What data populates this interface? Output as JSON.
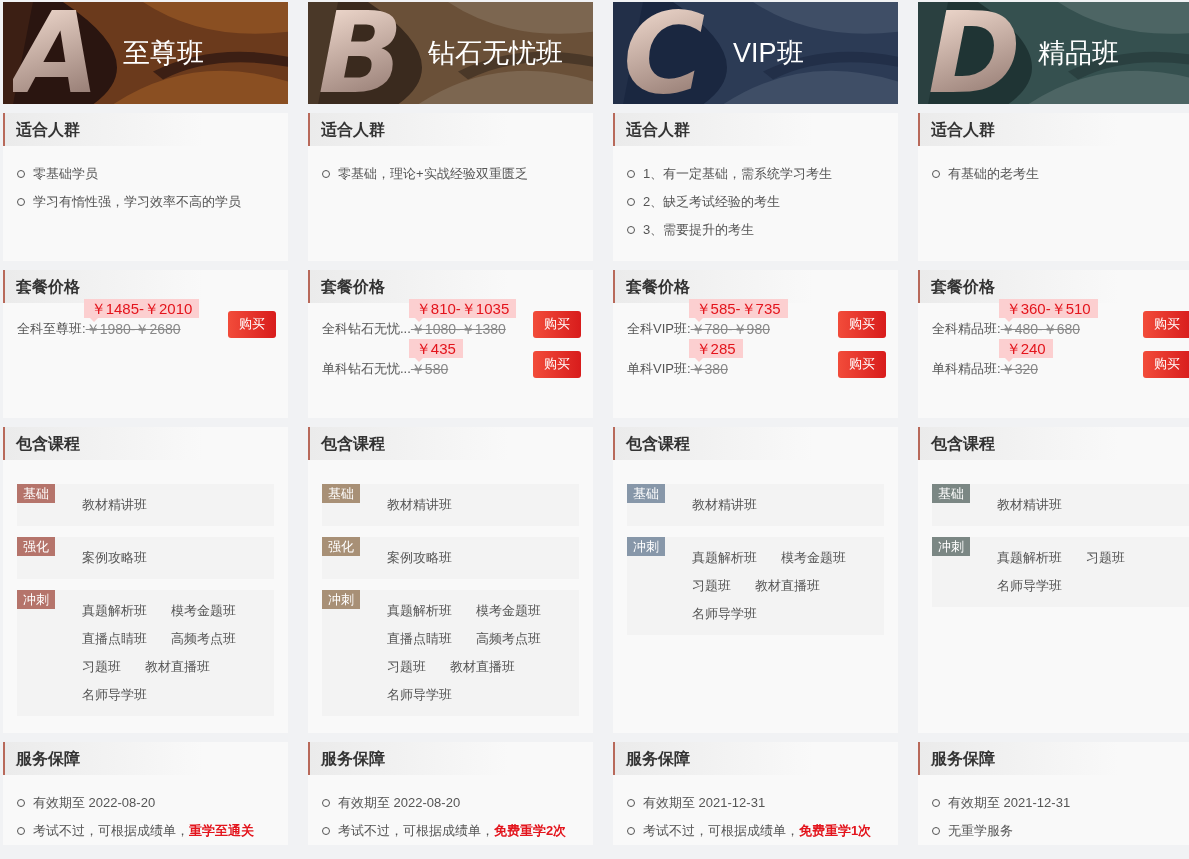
{
  "plans": [
    {
      "letter": "A",
      "title": "至尊班",
      "color": "#b5746b",
      "audience": {
        "title": "适合人群",
        "items": [
          "零基础学员",
          "学习有惰性强，学习效率不高的学员"
        ]
      },
      "pricing": {
        "title": "套餐价格",
        "rows": [
          {
            "label": "全科至尊班:",
            "original": "￥1980-￥2680",
            "sale": "￥1485-￥2010",
            "button": "购买"
          }
        ]
      },
      "courses": {
        "title": "包含课程",
        "groups": [
          {
            "stage": "基础",
            "items": [
              "教材精讲班"
            ]
          },
          {
            "stage": "强化",
            "items": [
              "案例攻略班"
            ]
          },
          {
            "stage": "冲刺",
            "items": [
              "真题解析班",
              "模考金题班",
              "直播点睛班",
              "高频考点班",
              "习题班",
              "教材直播班",
              "名师导学班"
            ]
          }
        ]
      },
      "service": {
        "title": "服务保障",
        "items": [
          "有效期至 2022-08-20",
          "考试不过，可根据成绩单，**重学至通关**"
        ]
      }
    },
    {
      "letter": "B",
      "title": "钻石无忧班",
      "color": "#a89076",
      "audience": {
        "title": "适合人群",
        "items": [
          "零基础，理论+实战经验双重匮乏"
        ]
      },
      "pricing": {
        "title": "套餐价格",
        "rows": [
          {
            "label": "全科钻石无忧...",
            "original": "￥1080-￥1380",
            "sale": "￥810-￥1035",
            "button": "购买"
          },
          {
            "label": "单科钻石无忧...",
            "original": "￥580",
            "sale": "￥435",
            "button": "购买"
          }
        ]
      },
      "courses": {
        "title": "包含课程",
        "groups": [
          {
            "stage": "基础",
            "items": [
              "教材精讲班"
            ]
          },
          {
            "stage": "强化",
            "items": [
              "案例攻略班"
            ]
          },
          {
            "stage": "冲刺",
            "items": [
              "真题解析班",
              "模考金题班",
              "直播点睛班",
              "高频考点班",
              "习题班",
              "教材直播班",
              "名师导学班"
            ]
          }
        ]
      },
      "service": {
        "title": "服务保障",
        "items": [
          "有效期至 2022-08-20",
          "考试不过，可根据成绩单，**免费重学2次**"
        ]
      }
    },
    {
      "letter": "C",
      "title": "VIP班",
      "color": "#8797a9",
      "audience": {
        "title": "适合人群",
        "items": [
          "1、有一定基础，需系统学习考生",
          "2、缺乏考试经验的考生",
          "3、需要提升的考生"
        ]
      },
      "pricing": {
        "title": "套餐价格",
        "rows": [
          {
            "label": "全科VIP班:",
            "original": "￥780-￥980",
            "sale": "￥585-￥735",
            "button": "购买"
          },
          {
            "label": "单科VIP班:",
            "original": "￥380",
            "sale": "￥285",
            "button": "购买"
          }
        ]
      },
      "courses": {
        "title": "包含课程",
        "groups": [
          {
            "stage": "基础",
            "items": [
              "教材精讲班"
            ]
          },
          {
            "stage": "冲刺",
            "items": [
              "真题解析班",
              "模考金题班",
              "习题班",
              "教材直播班",
              "名师导学班"
            ]
          }
        ]
      },
      "service": {
        "title": "服务保障",
        "items": [
          "有效期至 2021-12-31",
          "考试不过，可根据成绩单，**免费重学1次**"
        ]
      }
    },
    {
      "letter": "D",
      "title": "精品班",
      "color": "#7b8784",
      "audience": {
        "title": "适合人群",
        "items": [
          "有基础的老考生"
        ]
      },
      "pricing": {
        "title": "套餐价格",
        "rows": [
          {
            "label": "全科精品班:",
            "original": "￥480-￥680",
            "sale": "￥360-￥510",
            "button": "购买"
          },
          {
            "label": "单科精品班:",
            "original": "￥320",
            "sale": "￥240",
            "button": "购买"
          }
        ]
      },
      "courses": {
        "title": "包含课程",
        "groups": [
          {
            "stage": "基础",
            "items": [
              "教材精讲班"
            ]
          },
          {
            "stage": "冲刺",
            "items": [
              "真题解析班",
              "习题班",
              "名师导学班"
            ]
          }
        ]
      },
      "service": {
        "title": "服务保障",
        "items": [
          "有效期至 2021-12-31",
          "无重学服务"
        ]
      }
    }
  ]
}
